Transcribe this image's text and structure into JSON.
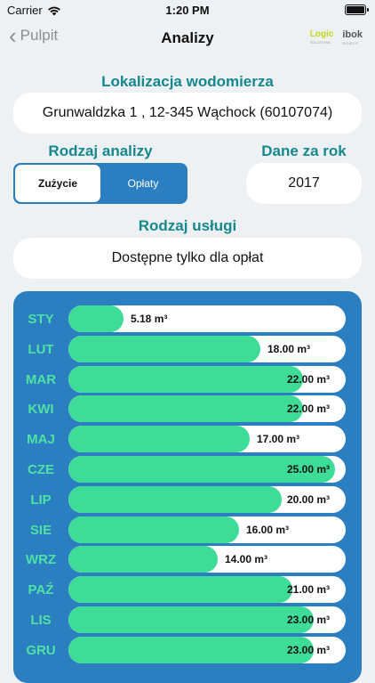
{
  "status": {
    "carrier": "Carrier",
    "time": "1:20 PM"
  },
  "nav": {
    "back_label": "Pulpit",
    "title": "Analizy",
    "logo_logic": "Logic",
    "logo_logic_sub": "SOLUTIONS",
    "logo_ibok": "ibok",
    "logo_ibok_sub": "MOBILE"
  },
  "location": {
    "label": "Lokalizacja wodomierza",
    "value": "Grunwaldzka 1 , 12-345 Wąchock (60107074)"
  },
  "analysis": {
    "label": "Rodzaj analizy",
    "options": [
      "Zużycie",
      "Opłaty"
    ],
    "selected": "Zużycie"
  },
  "year": {
    "label": "Dane za rok",
    "value": "2017"
  },
  "service": {
    "label": "Rodzaj usługi",
    "value": "Dostępne tylko dla opłat"
  },
  "colors": {
    "accent": "#15888e",
    "panel": "#2b7ec0",
    "bar": "#3ddc97",
    "month": "#4de3a4"
  },
  "chart_data": {
    "type": "bar",
    "orientation": "horizontal",
    "categories": [
      "STY",
      "LUT",
      "MAR",
      "KWI",
      "MAJ",
      "CZE",
      "LIP",
      "SIE",
      "WRZ",
      "PAŹ",
      "LIS",
      "GRU"
    ],
    "values": [
      5.18,
      18.0,
      22.0,
      22.0,
      17.0,
      25.0,
      20.0,
      16.0,
      14.0,
      21.0,
      23.0,
      23.0
    ],
    "labels": [
      "5.18 m³",
      "18.00 m³",
      "22.00 m³",
      "22.00 m³",
      "17.00 m³",
      "25.00 m³",
      "20.00 m³",
      "16.00 m³",
      "14.00 m³",
      "21.00 m³",
      "23.00 m³",
      "23.00 m³"
    ],
    "xlim": [
      0,
      25
    ]
  }
}
